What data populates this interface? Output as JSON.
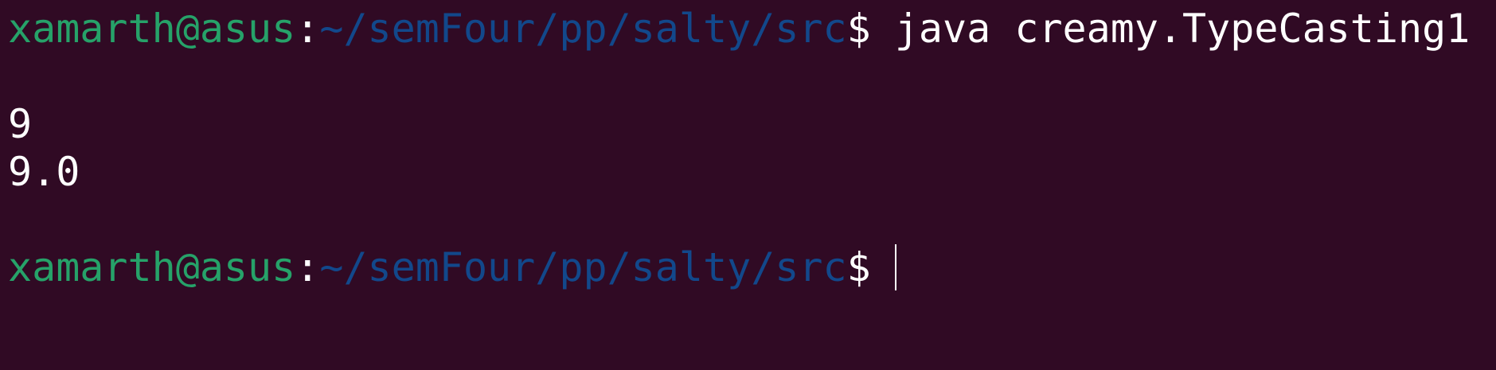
{
  "colors": {
    "background": "#300a24",
    "user_host": "#26a269",
    "path": "#12488b",
    "text": "#ffffff"
  },
  "prompt": {
    "user_host": "xamarth@asus",
    "separator": ":",
    "path": "~/semFour/pp/salty/src",
    "symbol": "$"
  },
  "command": "java creamy.TypeCasting1",
  "output": [
    "9",
    "9.0"
  ]
}
